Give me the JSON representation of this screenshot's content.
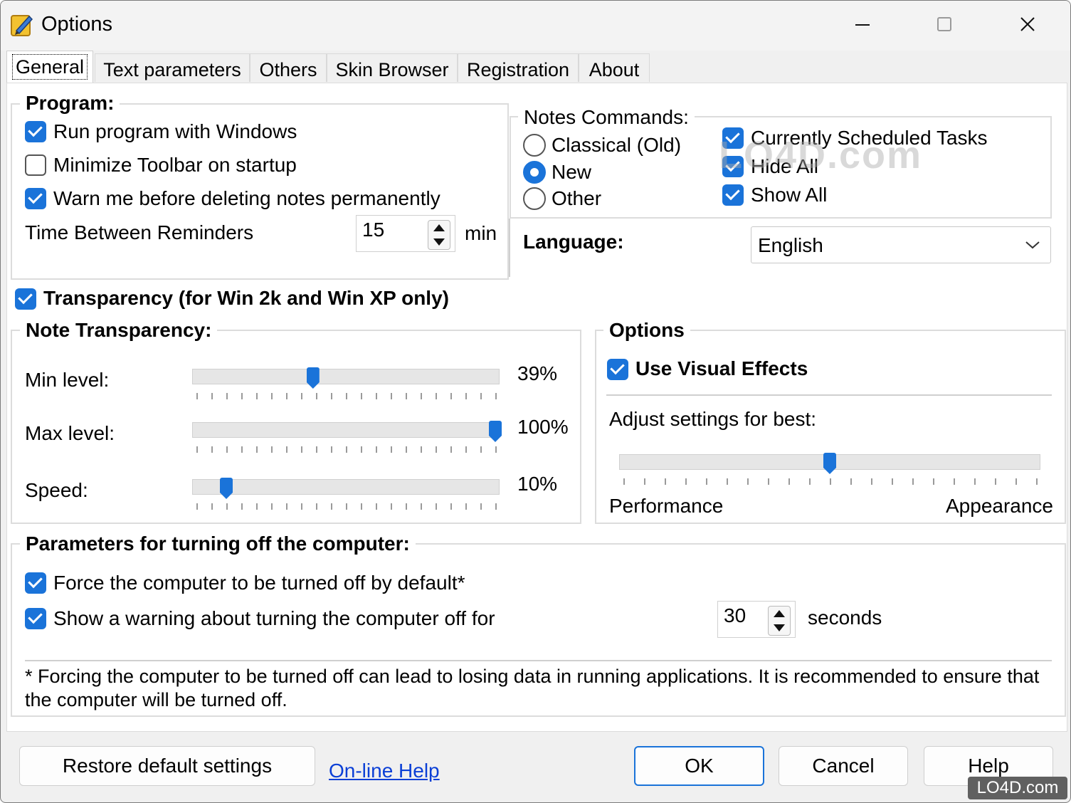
{
  "window": {
    "title": "Options"
  },
  "tabs": [
    {
      "label": "General"
    },
    {
      "label": "Text parameters"
    },
    {
      "label": "Others"
    },
    {
      "label": "Skin Browser"
    },
    {
      "label": "Registration"
    },
    {
      "label": "About"
    }
  ],
  "program": {
    "legend": "Program:",
    "run_with_windows": {
      "label": "Run program with Windows",
      "checked": true
    },
    "minimize_toolbar": {
      "label": "Minimize Toolbar on startup",
      "checked": false
    },
    "warn_delete": {
      "label": "Warn me before deleting notes permanently",
      "checked": true
    },
    "reminders_label": "Time Between Reminders",
    "reminders_value": "15",
    "reminders_unit": "min"
  },
  "notes_commands": {
    "legend": "Notes Commands:",
    "radios": [
      {
        "label": "Classical (Old)",
        "selected": false
      },
      {
        "label": "New",
        "selected": true
      },
      {
        "label": "Other",
        "selected": false
      }
    ],
    "checks": [
      {
        "label": "Currently Scheduled Tasks",
        "checked": true
      },
      {
        "label": "Hide All",
        "checked": true
      },
      {
        "label": "Show All",
        "checked": true
      }
    ]
  },
  "language": {
    "label": "Language:",
    "value": "English"
  },
  "transparency": {
    "label": "Transparency (for Win 2k and Win XP only)",
    "checked": true
  },
  "note_transparency": {
    "legend": "Note Transparency:",
    "sliders": [
      {
        "label": "Min level:",
        "value_text": "39%",
        "value": 0.39
      },
      {
        "label": "Max level:",
        "value_text": "100%",
        "value": 1.0
      },
      {
        "label": "Speed:",
        "value_text": "10%",
        "value": 0.1
      }
    ]
  },
  "options": {
    "legend": "Options",
    "visual_effects": {
      "label": "Use Visual Effects",
      "checked": true
    },
    "adjust_label": "Adjust settings for best:",
    "slider_value": 0.5,
    "left_label": "Performance",
    "right_label": "Appearance"
  },
  "shutdown": {
    "legend": "Parameters for turning off the computer:",
    "force": {
      "label": "Force the computer to be turned off by default*",
      "checked": true
    },
    "warning": {
      "label": "Show a warning about turning the computer off for",
      "checked": true
    },
    "seconds_value": "30",
    "seconds_unit": "seconds",
    "note": "* Forcing the computer to be turned off can lead to losing data in running applications. It is recommended to ensure that the computer will be turned off."
  },
  "footer": {
    "restore": "Restore default settings",
    "online_help": "On-line Help",
    "ok": "OK",
    "cancel": "Cancel",
    "help": "Help"
  },
  "watermark": {
    "text": "LO4D.com",
    "badge": "LO4D.com"
  },
  "colors": {
    "accent": "#1a73d9",
    "link": "#0b3fd6",
    "panel": "#ffffff",
    "window": "#f0f0f0"
  }
}
